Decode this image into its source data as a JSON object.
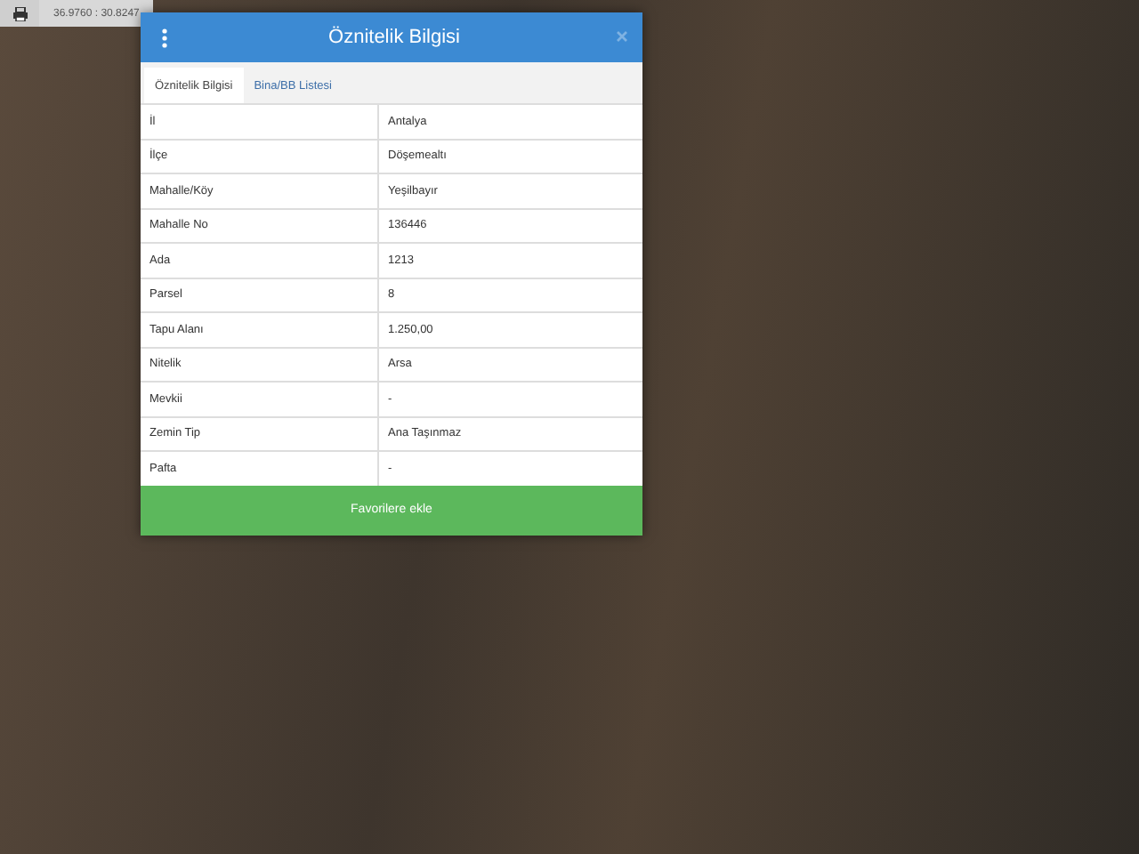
{
  "toolbar": {
    "coordinates": "36.9760 : 30.8247"
  },
  "panel": {
    "title": "Öznitelik Bilgisi",
    "tabs": [
      {
        "label": "Öznitelik Bilgisi",
        "selected": true
      },
      {
        "label": "Bina/BB Listesi",
        "selected": false
      }
    ],
    "rows": [
      {
        "label": "İl",
        "value": "Antalya"
      },
      {
        "label": "İlçe",
        "value": "Döşemealtı"
      },
      {
        "label": "Mahalle/Köy",
        "value": "Yeşilbayır"
      },
      {
        "label": "Mahalle No",
        "value": "136446"
      },
      {
        "label": "Ada",
        "value": "1213"
      },
      {
        "label": "Parsel",
        "value": "8"
      },
      {
        "label": "Tapu Alanı",
        "value": "1.250,00"
      },
      {
        "label": "Nitelik",
        "value": "Arsa"
      },
      {
        "label": "Mevkii",
        "value": "-"
      },
      {
        "label": "Zemin Tip",
        "value": "Ana Taşınmaz"
      },
      {
        "label": "Pafta",
        "value": "-"
      }
    ],
    "button": "Favorilere ekle"
  }
}
